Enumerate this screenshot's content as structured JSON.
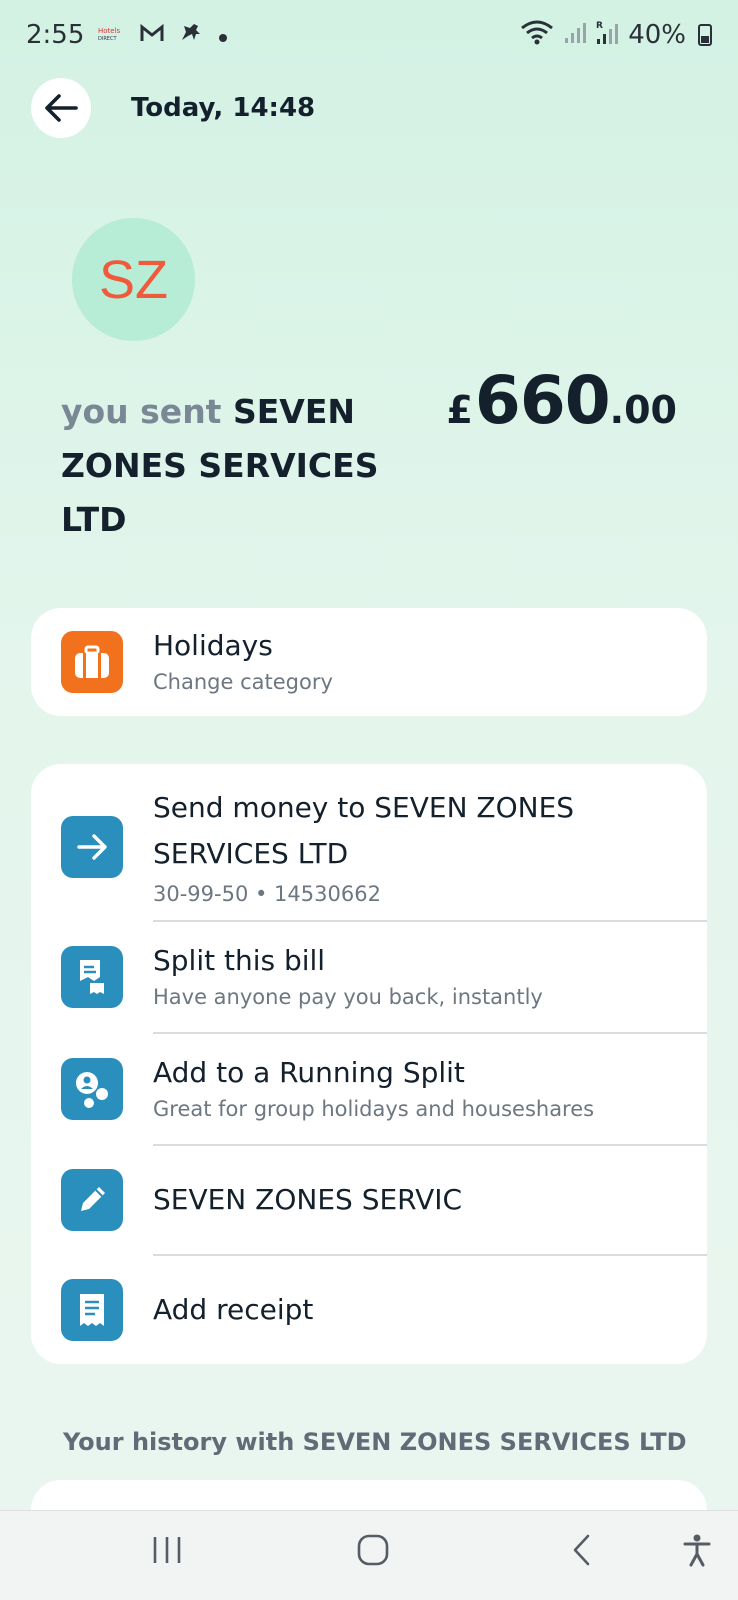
{
  "status_bar": {
    "time": "2:55",
    "battery": "40%",
    "notification_icons": [
      "hotels-app-icon",
      "gmail-icon",
      "lloyds-horse-icon",
      "dot-icon"
    ],
    "system_icons": [
      "wifi-icon",
      "signal-icon",
      "roaming-signal-icon",
      "battery-icon"
    ]
  },
  "header": {
    "title": "Today, 14:48"
  },
  "merchant": {
    "initials": "SZ",
    "sent_prefix": "you sent",
    "name": "SEVEN ZONES SERVICES LTD"
  },
  "amount": {
    "currency": "£",
    "major": "660",
    "minor": ".00"
  },
  "category": {
    "title": "Holidays",
    "subtitle": "Change category",
    "icon": "suitcase-icon"
  },
  "actions": [
    {
      "title": "Send money to SEVEN ZONES SERVICES LTD",
      "subtitle": "30-99-50 • 14530662",
      "icon": "arrow-right-icon"
    },
    {
      "title": "Split this bill",
      "subtitle": "Have anyone pay you back, instantly",
      "icon": "split-bill-icon"
    },
    {
      "title": "Add to a Running Split",
      "subtitle": "Great for group holidays and houseshares",
      "icon": "running-split-icon"
    },
    {
      "title": "SEVEN ZONES SERVIC",
      "subtitle": "",
      "icon": "pencil-icon"
    },
    {
      "title": "Add receipt",
      "subtitle": "",
      "icon": "receipt-icon"
    }
  ],
  "history": {
    "label": "Your history with SEVEN ZONES SERVICES LTD"
  },
  "colors": {
    "background": "#d3f2e4",
    "accent_orange": "#f2711c",
    "accent_teal": "#2a8fbd",
    "avatar_bg": "#b7ecd6",
    "avatar_text": "#ef5a3c"
  }
}
